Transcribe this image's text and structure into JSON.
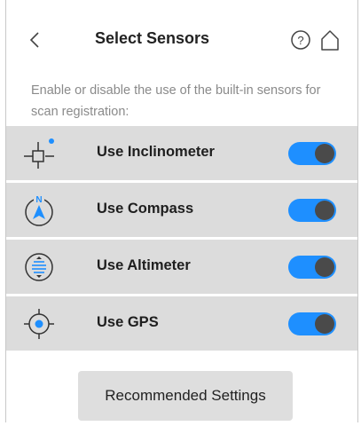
{
  "header": {
    "title": "Select Sensors",
    "back_icon": "chevron-left-icon",
    "help_icon": "help-circle-icon",
    "home_icon": "home-icon"
  },
  "description": "Enable or disable the use of the built-in sensors for scan registration:",
  "sensors": [
    {
      "label": "Use Inclinometer",
      "icon": "inclinometer-icon",
      "enabled": true
    },
    {
      "label": "Use Compass",
      "icon": "compass-icon",
      "enabled": true
    },
    {
      "label": "Use Altimeter",
      "icon": "altimeter-icon",
      "enabled": true
    },
    {
      "label": "Use GPS",
      "icon": "gps-icon",
      "enabled": true
    }
  ],
  "recommended_button": "Recommended Settings",
  "colors": {
    "accent": "#1e8fff",
    "row_background": "#dcdcdc",
    "knob": "#4a4a4a"
  }
}
